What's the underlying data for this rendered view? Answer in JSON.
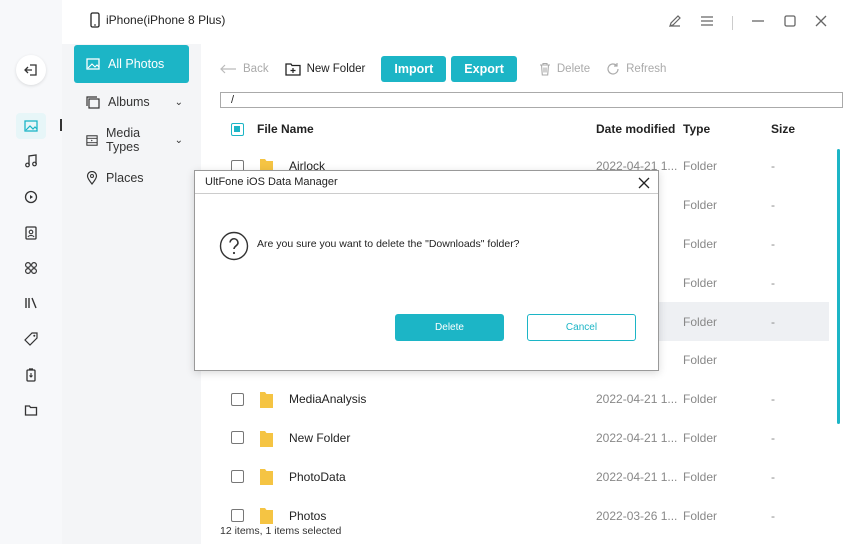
{
  "window": {
    "device_title": "iPhone(iPhone 8 Plus)",
    "controls": [
      "feedback-icon",
      "menu-icon",
      "minimize-icon",
      "maximize-icon",
      "close-icon"
    ]
  },
  "rail": {
    "items": [
      "back-icon",
      "photos-icon",
      "music-icon",
      "video-icon",
      "contacts-icon",
      "apps-icon",
      "books-icon",
      "tag-icon",
      "backup-icon",
      "files-icon"
    ],
    "active": "photos-icon"
  },
  "categories": [
    {
      "label": "All Photos",
      "icon": "image-icon",
      "active": true
    },
    {
      "label": "Albums",
      "icon": "albums-icon",
      "expandable": true
    },
    {
      "label": "Media Types",
      "icon": "media-types-icon",
      "expandable": true
    },
    {
      "label": "Places",
      "icon": "location-icon"
    }
  ],
  "toolbar": {
    "back": "Back",
    "new_folder": "New Folder",
    "import": "Import",
    "export": "Export",
    "delete": "Delete",
    "refresh": "Refresh"
  },
  "path": "/",
  "table": {
    "headers": {
      "name": "File Name",
      "date": "Date modified",
      "type": "Type",
      "size": "Size"
    },
    "rows": [
      {
        "name": "Airlock",
        "date": "2022-04-21 1...",
        "type": "Folder",
        "size": "-"
      },
      {
        "name": "",
        "date": "",
        "type": "Folder",
        "size": "-"
      },
      {
        "name": "",
        "date": "",
        "type": "Folder",
        "size": "-"
      },
      {
        "name": "",
        "date": "",
        "type": "Folder",
        "size": "-"
      },
      {
        "name": "",
        "date": "",
        "type": "Folder",
        "size": "-"
      },
      {
        "name": "",
        "date": "",
        "type": "Folder",
        "size": ""
      },
      {
        "name": "MediaAnalysis",
        "date": "2022-04-21 1...",
        "type": "Folder",
        "size": "-"
      },
      {
        "name": "New Folder",
        "date": "2022-04-21 1...",
        "type": "Folder",
        "size": "-"
      },
      {
        "name": "PhotoData",
        "date": "2022-04-21 1...",
        "type": "Folder",
        "size": "-"
      },
      {
        "name": "Photos",
        "date": "2022-03-26 1...",
        "type": "Folder",
        "size": "-"
      }
    ]
  },
  "status": "12 items, 1 items selected",
  "dialog": {
    "title": "UltFone iOS Data Manager",
    "message": "Are you sure you want to delete the \"Downloads\" folder?",
    "confirm": "Delete",
    "cancel": "Cancel"
  },
  "colors": {
    "accent": "#1cb5c6",
    "folder": "#f5c443"
  }
}
